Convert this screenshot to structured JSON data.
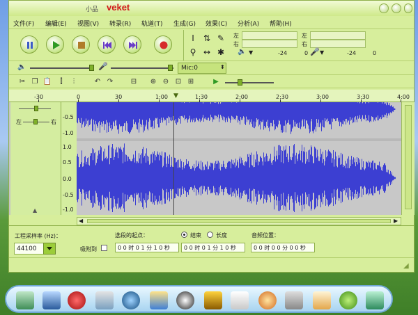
{
  "window": {
    "title_small": "小品",
    "title_main": "veket",
    "controls": [
      "◉",
      "◉",
      "◉"
    ]
  },
  "menu": [
    "文件(F)",
    "编辑(E)",
    "视图(V)",
    "转录(R)",
    "轨道(T)",
    "生成(G)",
    "效果(C)",
    "分析(A)",
    "帮助(H)"
  ],
  "meters": {
    "left_label": "左",
    "right_label": "右",
    "play_scale": [
      "-24",
      "0"
    ],
    "rec_scale": [
      "-24",
      "0"
    ]
  },
  "mixer": {
    "mic_select": "Mic:0"
  },
  "ruler": {
    "ticks": [
      "-30",
      "0",
      "30",
      "1:00",
      "1:30",
      "2:00",
      "2:30",
      "3:00",
      "3:30",
      "4:00"
    ]
  },
  "track": {
    "pan_left": "左",
    "pan_right": "右",
    "scale_top": [
      "-0.5",
      "-1.0"
    ],
    "scale_bottom": [
      "1.0",
      "0.5",
      "0.0",
      "-0.5",
      "-1.0"
    ]
  },
  "bottom": {
    "project_rate_label": "工程采样率 (Hz)：",
    "project_rate_value": "44100",
    "snap_label": "吸附到",
    "selection_start_label": "选段的起点：",
    "end_label": "结束",
    "length_label": "长度",
    "audio_position_label": "音频位置：",
    "sel_start_value": "0 0 时 0 1 分 1 0 秒",
    "sel_end_value": "0 0 时 0 1 分 1 0 秒",
    "audio_pos_value": "0 0 时 0 0 分 0 0 秒"
  },
  "colors": {
    "window_bg": "#d7ee9c",
    "waveform": "#3c3fd2",
    "accent_green": "#9ccd3a"
  }
}
